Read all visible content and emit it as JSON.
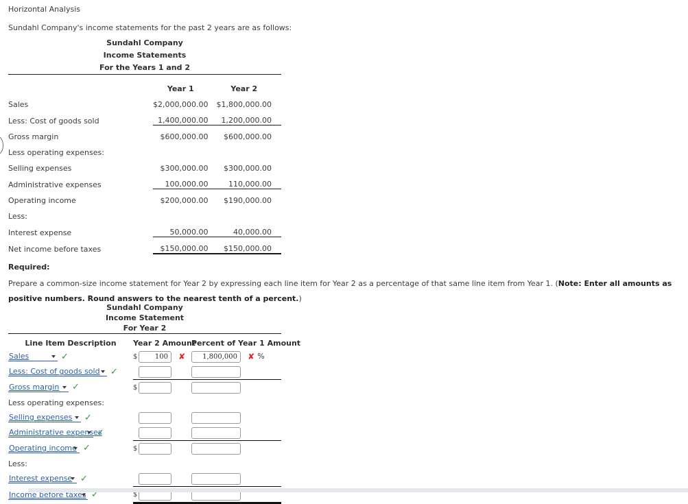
{
  "intro": {
    "title": "Horizontal Analysis",
    "subtitle": "Sundahl Company's income statements for the past 2 years are as follows:"
  },
  "statement1": {
    "heading_line1": "Sundahl Company",
    "heading_line2": "Income Statements",
    "heading_line3": "For the Years 1 and 2",
    "columns": [
      "",
      "Year 1",
      "Year 2"
    ],
    "rows": [
      {
        "label": "Sales",
        "indent": 0,
        "year1": "$2,000,000.00",
        "year2": "$1,800,000.00",
        "rule": "none"
      },
      {
        "label": "Less: Cost of goods sold",
        "indent": 0,
        "year1": "1,400,000.00",
        "year2": "1,200,000.00",
        "rule": "none"
      },
      {
        "label": "Gross margin",
        "indent": 1,
        "year1": "$600,000.00",
        "year2": "$600,000.00",
        "rule": "above"
      },
      {
        "label": "Less operating expenses:",
        "indent": 0,
        "year1": "",
        "year2": "",
        "rule": "none"
      },
      {
        "label": "Selling expenses",
        "indent": 1,
        "year1": "$300,000.00",
        "year2": "$300,000.00",
        "rule": "none"
      },
      {
        "label": "Administrative expenses",
        "indent": 1,
        "year1": "100,000.00",
        "year2": "110,000.00",
        "rule": "none"
      },
      {
        "label": "Operating income",
        "indent": 0,
        "year1": "$200,000.00",
        "year2": "$190,000.00",
        "rule": "above"
      },
      {
        "label": "Less:",
        "indent": 0,
        "year1": "",
        "year2": "",
        "rule": "none"
      },
      {
        "label": "Interest expense",
        "indent": 0,
        "year1": "50,000.00",
        "year2": "40,000.00",
        "rule": "none"
      },
      {
        "label": "Net income before taxes",
        "indent": 1,
        "year1": "$150,000.00",
        "year2": "$150,000.00",
        "rule": "above-double-below"
      }
    ]
  },
  "required": {
    "label": "Required:",
    "text_part1": "Prepare a common-size income statement for Year 2 by expressing each line item for Year 2 as a percentage of that same line item from Year 1. (",
    "note_bold": "Note: Enter all amounts as positive numbers. Round answers to the nearest tenth of a percent.",
    "text_part2": ")"
  },
  "statement2": {
    "heading_line1": "Sundahl Company",
    "heading_line2": "Income Statement",
    "heading_line3": "For Year 2",
    "headers": {
      "line_item": "Line Item Description",
      "year2_amount": "Year 2 Amount",
      "percent_year1": "Percent of Year 1 Amount"
    },
    "percent_symbol": "%",
    "dollar_symbol": "$",
    "check_mark": "✓",
    "cross_mark": "✘",
    "rows": [
      {
        "kind": "select",
        "select_value": "Sales",
        "select_width": "w1",
        "status": "ok",
        "amount_prefix": "$",
        "amount_value": "100",
        "amount_status": "bad",
        "percent_value": "1,800,000",
        "percent_status": "bad",
        "percent_suffix": "%",
        "rule": "none"
      },
      {
        "kind": "select",
        "select_value": "Less: Cost of goods sold",
        "select_width": "w2",
        "status": "ok",
        "amount_prefix": "",
        "amount_value": "",
        "amount_status": "none",
        "percent_value": "",
        "percent_status": "none",
        "percent_suffix": "",
        "rule": "single"
      },
      {
        "kind": "select",
        "select_value": "Gross margin",
        "select_width": "w3",
        "status": "ok",
        "amount_prefix": "$",
        "amount_value": "",
        "amount_status": "none",
        "percent_value": "",
        "percent_status": "none",
        "percent_suffix": "",
        "rule": "none"
      },
      {
        "kind": "text",
        "text_value": "Less operating expenses:",
        "amount_prefix": "",
        "amount_value": "",
        "amount_status": "none",
        "percent_value": "",
        "percent_status": "none",
        "percent_suffix": "",
        "rule": "none"
      },
      {
        "kind": "select",
        "select_value": "Selling expenses",
        "select_width": "w4",
        "status": "ok",
        "amount_prefix": "",
        "amount_value": "",
        "amount_status": "none",
        "percent_value": "",
        "percent_status": "none",
        "percent_suffix": "",
        "rule": "none"
      },
      {
        "kind": "select",
        "select_value": "Administrative expenses",
        "select_width": "w5",
        "status": "ok",
        "amount_prefix": "",
        "amount_value": "",
        "amount_status": "none",
        "percent_value": "",
        "percent_status": "none",
        "percent_suffix": "",
        "rule": "single"
      },
      {
        "kind": "select",
        "select_value": "Operating income",
        "select_width": "w6",
        "status": "ok",
        "amount_prefix": "$",
        "amount_value": "",
        "amount_status": "none",
        "percent_value": "",
        "percent_status": "none",
        "percent_suffix": "",
        "rule": "none"
      },
      {
        "kind": "text",
        "text_value": "Less:",
        "amount_prefix": "",
        "amount_value": "",
        "amount_status": "none",
        "percent_value": "",
        "percent_status": "none",
        "percent_suffix": "",
        "rule": "none"
      },
      {
        "kind": "select",
        "select_value": "Interest expense",
        "select_width": "w7",
        "status": "ok",
        "amount_prefix": "",
        "amount_value": "",
        "amount_status": "none",
        "percent_value": "",
        "percent_status": "none",
        "percent_suffix": "",
        "rule": "single"
      },
      {
        "kind": "select",
        "select_value": "Income before taxes",
        "select_width": "w8",
        "status": "ok",
        "amount_prefix": "$",
        "amount_value": "",
        "amount_status": "none",
        "percent_value": "",
        "percent_status": "none",
        "percent_suffix": "",
        "rule": "double"
      }
    ]
  },
  "colors": {
    "link": "#2b5fa8",
    "success": "#2f9e2f",
    "error": "#e02020",
    "text": "#3b3b3b",
    "rule": "#111111",
    "bottom_bar": "#e4e7ec"
  }
}
